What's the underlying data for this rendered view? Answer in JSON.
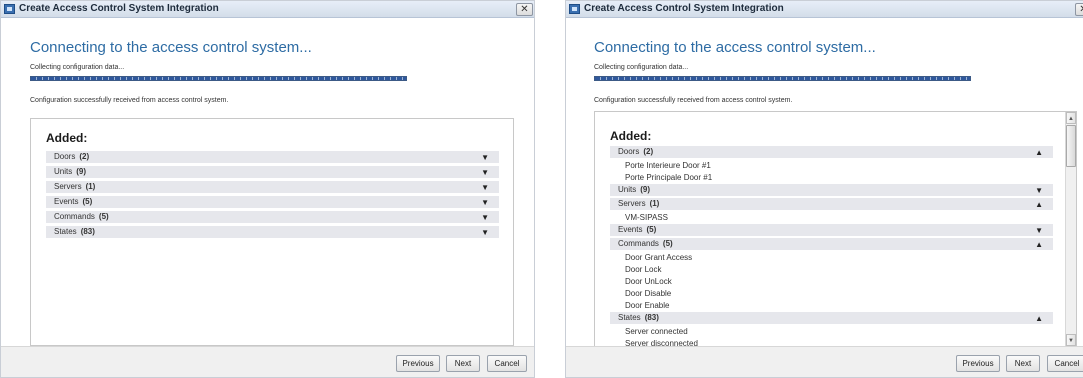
{
  "window_title": "Create Access Control System Integration",
  "heading": "Connecting to the access control system...",
  "status": "Collecting configuration data...",
  "success_message": "Configuration successfully received from access control system.",
  "added_label": "Added:",
  "chevrons": {
    "collapsed": "▼",
    "expanded": "▲"
  },
  "left_panel": {
    "categories": [
      {
        "name": "Doors",
        "count": "(2)"
      },
      {
        "name": "Units",
        "count": "(9)"
      },
      {
        "name": "Servers",
        "count": "(1)"
      },
      {
        "name": "Events",
        "count": "(5)"
      },
      {
        "name": "Commands",
        "count": "(5)"
      },
      {
        "name": "States",
        "count": "(83)"
      }
    ]
  },
  "right_panel": {
    "categories": [
      {
        "name": "Doors",
        "count": "(2)",
        "children": [
          "Porte Interieure Door #1",
          "Porte Principale Door #1"
        ]
      },
      {
        "name": "Units",
        "count": "(9)",
        "children": []
      },
      {
        "name": "Servers",
        "count": "(1)",
        "children": [
          "VM-SIPASS"
        ]
      },
      {
        "name": "Events",
        "count": "(5)",
        "children": []
      },
      {
        "name": "Commands",
        "count": "(5)",
        "children": [
          "Door Grant Access",
          "Door Lock",
          "Door UnLock",
          "Door Disable",
          "Door Enable"
        ]
      },
      {
        "name": "States",
        "count": "(83)",
        "children": [
          "Server connected",
          "Server disconnected"
        ]
      }
    ]
  },
  "buttons": {
    "previous": "Previous",
    "next": "Next",
    "cancel": "Cancel"
  }
}
